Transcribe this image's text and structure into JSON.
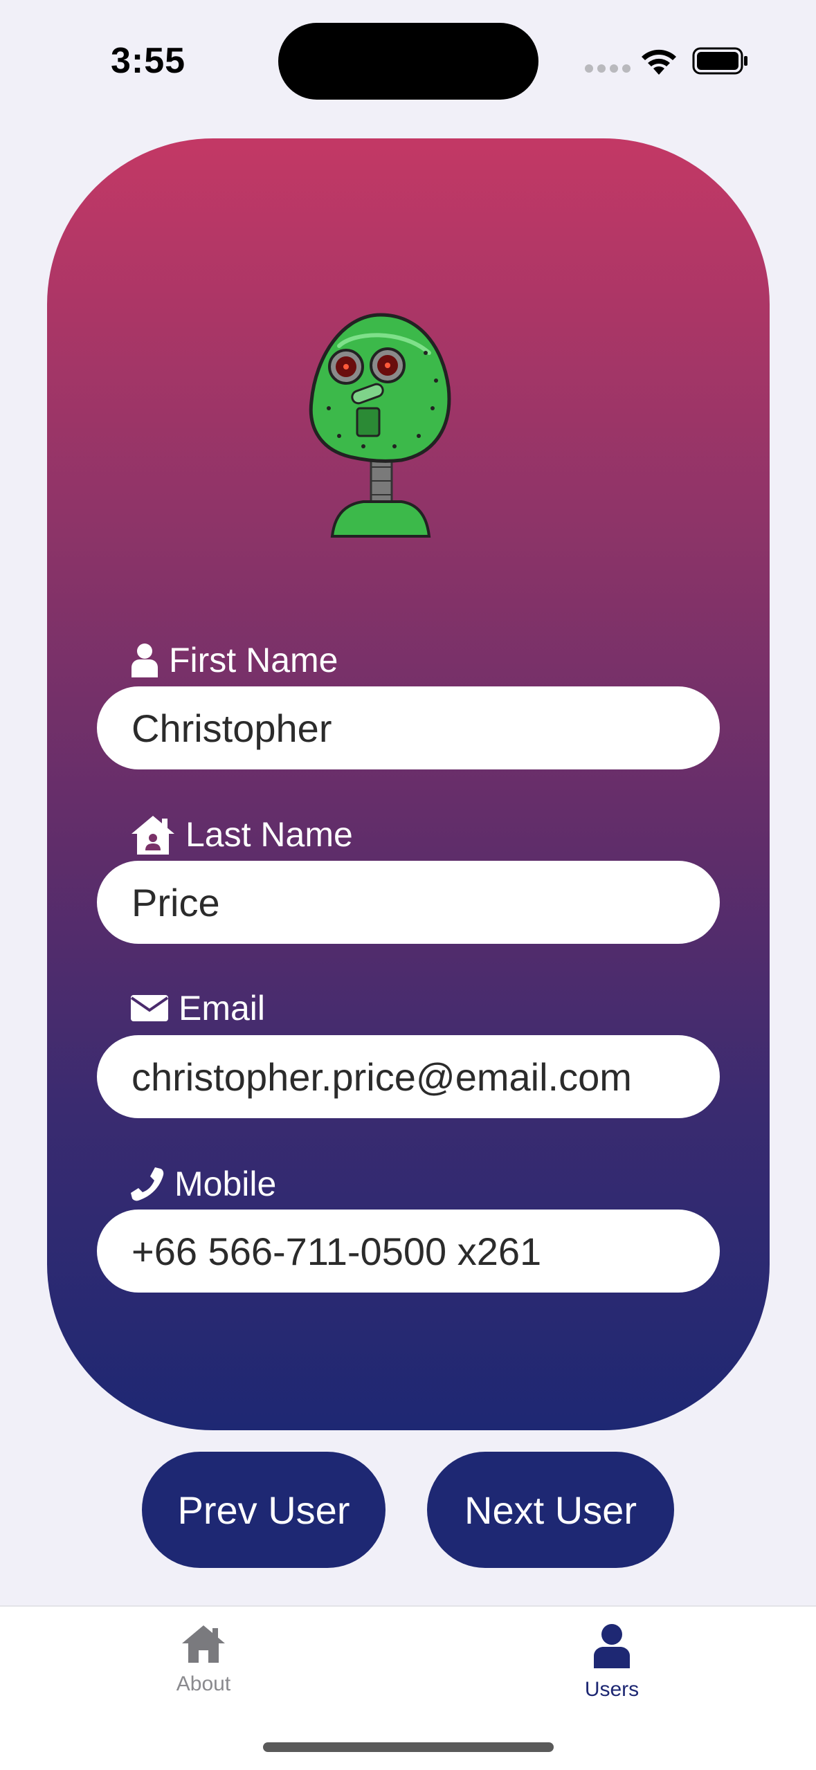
{
  "status_bar": {
    "time": "3:55"
  },
  "profile": {
    "fields": [
      {
        "label": "First Name",
        "value": "Christopher",
        "icon": "user-icon"
      },
      {
        "label": "Last Name",
        "value": "Price",
        "icon": "home-icon"
      },
      {
        "label": "Email",
        "value": "christopher.price@email.com",
        "icon": "envelope-icon"
      },
      {
        "label": "Mobile",
        "value": "+66 566-711-0500 x261",
        "icon": "phone-icon"
      }
    ]
  },
  "actions": {
    "prev_label": "Prev User",
    "next_label": "Next User"
  },
  "tabbar": {
    "items": [
      {
        "label": "About",
        "icon": "house-icon",
        "active": false
      },
      {
        "label": "Users",
        "icon": "person-icon",
        "active": true
      }
    ]
  },
  "colors": {
    "accent": "#1e2873",
    "card_top": "#c33865",
    "card_bottom": "#1e2873",
    "inactive_tab": "#8a8a8e"
  }
}
